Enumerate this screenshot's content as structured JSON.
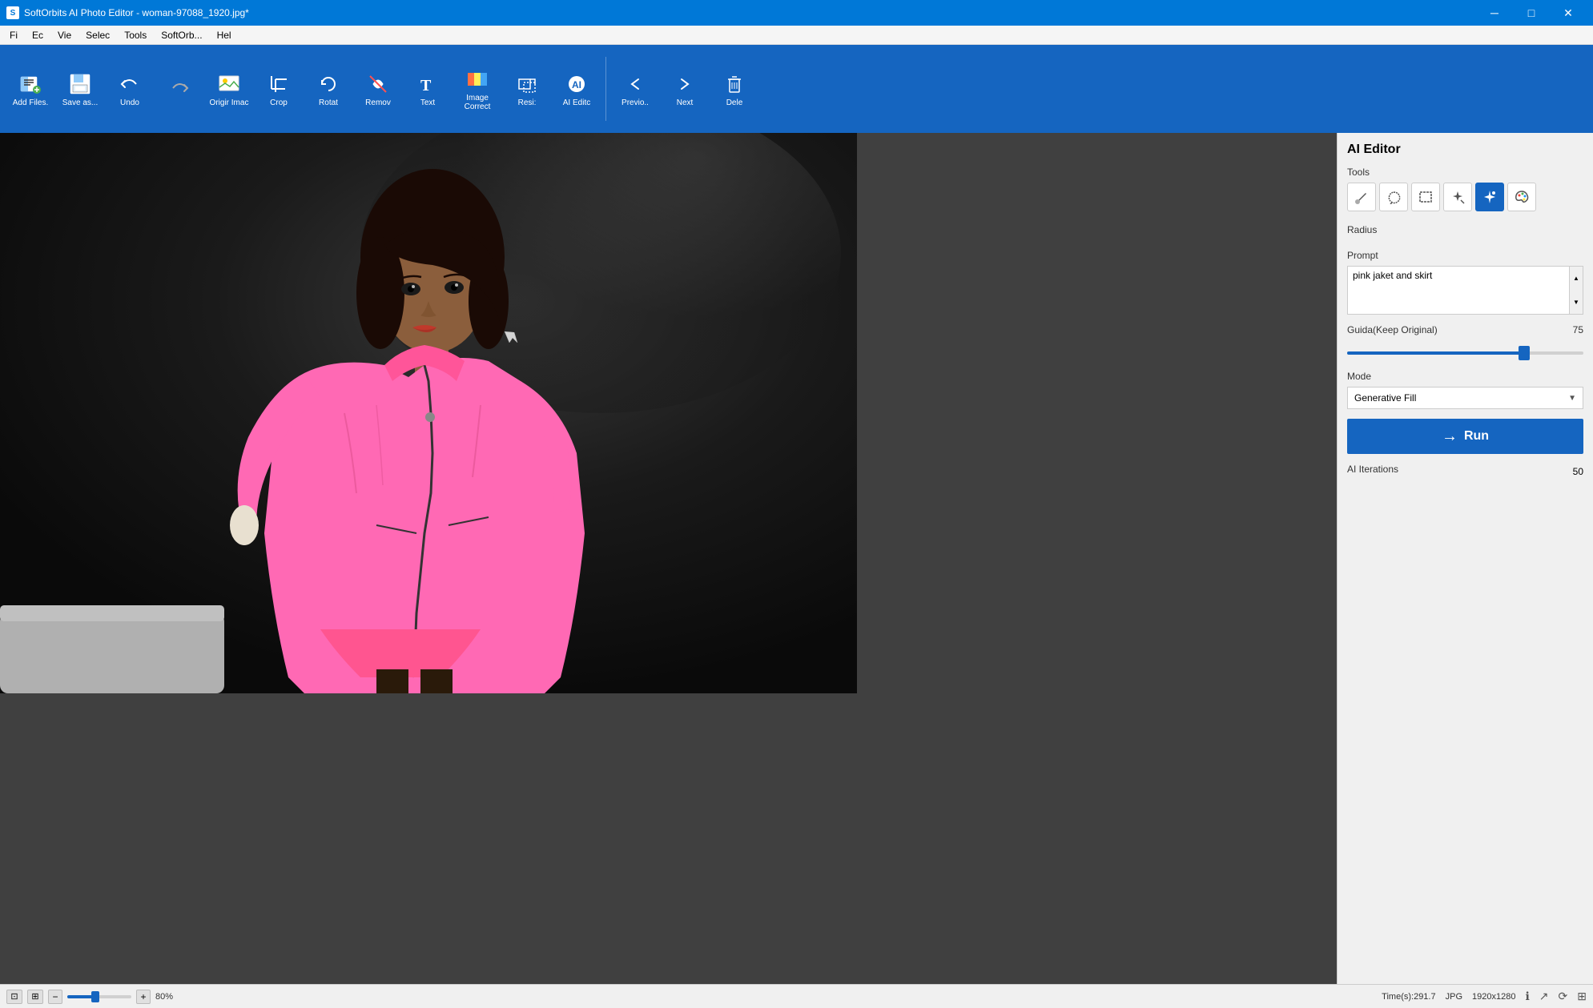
{
  "window": {
    "title": "SoftOrbits AI Photo Editor - woman-97088_1920.jpg*",
    "icon_label": "S"
  },
  "title_controls": {
    "minimize": "─",
    "maximize": "□",
    "close": "✕"
  },
  "menu": {
    "items": [
      "Fi",
      "Ec",
      "Vie",
      "Selec",
      "Tools",
      "SoftOrb...",
      "Hel"
    ]
  },
  "toolbar": {
    "buttons": [
      {
        "id": "add-files",
        "icon": "📁",
        "label": "Add\nFile(s)."
      },
      {
        "id": "save-as",
        "icon": "💾",
        "label": "Save\nas..."
      },
      {
        "id": "undo",
        "icon": "↩",
        "label": "Undo"
      },
      {
        "id": "redo",
        "icon": "↪",
        "label": ""
      },
      {
        "id": "original-image",
        "icon": "🖼",
        "label": "Origir\nImac"
      },
      {
        "id": "crop",
        "icon": "✂",
        "label": "Crop"
      },
      {
        "id": "rotate",
        "icon": "🔄",
        "label": "Rotat"
      },
      {
        "id": "remove",
        "icon": "🪄",
        "label": "Remov"
      },
      {
        "id": "text",
        "icon": "T",
        "label": "Text"
      },
      {
        "id": "image-correction",
        "icon": "🎨",
        "label": "Image\nCorrect"
      },
      {
        "id": "resize",
        "icon": "⤡",
        "label": "Resi:"
      },
      {
        "id": "ai-editor",
        "icon": "🤖",
        "label": "AI\nEditc"
      },
      {
        "id": "previous",
        "icon": "⬅",
        "label": "Previo.."
      },
      {
        "id": "next",
        "icon": "➡",
        "label": "Next"
      },
      {
        "id": "delete",
        "icon": "🗑",
        "label": "Dele"
      }
    ]
  },
  "right_panel": {
    "title": "AI Editor",
    "tools_label": "Tools",
    "tools": [
      {
        "id": "brush",
        "icon": "✏️",
        "active": false
      },
      {
        "id": "lasso",
        "icon": "⚡",
        "active": false
      },
      {
        "id": "rectangle",
        "icon": "⬜",
        "active": false
      },
      {
        "id": "magic-wand",
        "icon": "✦",
        "active": false
      },
      {
        "id": "sparkle",
        "icon": "✳",
        "active": true
      },
      {
        "id": "palette",
        "icon": "🎭",
        "active": false
      }
    ],
    "radius_label": "Radius",
    "prompt_label": "Prompt",
    "prompt_value": "pink jaket and skirt",
    "guidance_label": "Guida(Keep Original)",
    "guidance_value": "75",
    "guidance_percent": 75,
    "mode_label": "Mode",
    "mode_value": "Generative Fill",
    "run_label": "Run",
    "run_icon": "→",
    "iterations_label": "AI Iterations",
    "iterations_value": "50"
  },
  "status_bar": {
    "zoom_minus": "−",
    "zoom_plus": "+",
    "zoom_value": "80%",
    "time_label": "Time(s):291.7",
    "format": "JPG",
    "dimensions": "1920x1280",
    "icons": [
      "ℹ",
      "↗",
      "⟳",
      "⊞"
    ]
  }
}
